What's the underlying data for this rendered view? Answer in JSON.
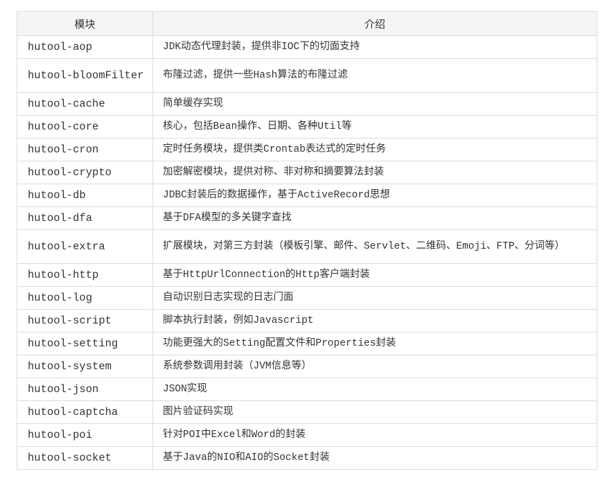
{
  "table": {
    "headers": [
      "模块",
      "介绍"
    ],
    "rows": [
      {
        "module": "hutool-aop",
        "desc": "JDK动态代理封装，提供非IOC下的切面支持"
      },
      {
        "module": "hutool-bloomFilter",
        "desc": "布隆过滤，提供一些Hash算法的布隆过滤"
      },
      {
        "module": "hutool-cache",
        "desc": "简单缓存实现"
      },
      {
        "module": "hutool-core",
        "desc": "核心，包括Bean操作、日期、各种Util等"
      },
      {
        "module": "hutool-cron",
        "desc": "定时任务模块，提供类Crontab表达式的定时任务"
      },
      {
        "module": "hutool-crypto",
        "desc": "加密解密模块，提供对称、非对称和摘要算法封装"
      },
      {
        "module": "hutool-db",
        "desc": "JDBC封装后的数据操作，基于ActiveRecord思想"
      },
      {
        "module": "hutool-dfa",
        "desc": "基于DFA模型的多关键字查找"
      },
      {
        "module": "hutool-extra",
        "desc": "扩展模块，对第三方封装（模板引擎、邮件、Servlet、二维码、Emoji、FTP、分词等）"
      },
      {
        "module": "hutool-http",
        "desc": "基于HttpUrlConnection的Http客户端封装"
      },
      {
        "module": "hutool-log",
        "desc": "自动识别日志实现的日志门面"
      },
      {
        "module": "hutool-script",
        "desc": "脚本执行封装，例如Javascript"
      },
      {
        "module": "hutool-setting",
        "desc": "功能更强大的Setting配置文件和Properties封装"
      },
      {
        "module": "hutool-system",
        "desc": "系统参数调用封装（JVM信息等）"
      },
      {
        "module": "hutool-json",
        "desc": "JSON实现"
      },
      {
        "module": "hutool-captcha",
        "desc": "图片验证码实现"
      },
      {
        "module": "hutool-poi",
        "desc": "针对POI中Excel和Word的封装"
      },
      {
        "module": "hutool-socket",
        "desc": "基于Java的NIO和AIO的Socket封装"
      }
    ]
  }
}
